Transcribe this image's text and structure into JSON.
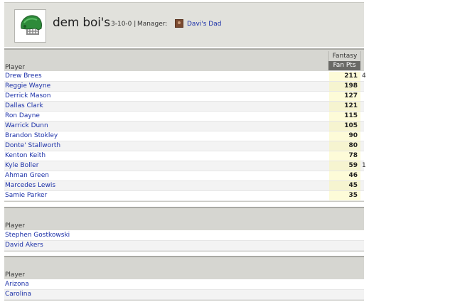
{
  "team": {
    "name": "dem boi's",
    "record": "3-10-0 |",
    "manager_label": "Manager:",
    "manager_name": "Davi's Dad"
  },
  "starters": {
    "player_header": "Player",
    "group_header": "Fantasy",
    "points_header": "Fan Pts",
    "rows": [
      {
        "name": "Drew Brees",
        "pts": "211",
        "cut": "4"
      },
      {
        "name": "Reggie Wayne",
        "pts": "198",
        "cut": ""
      },
      {
        "name": "Derrick Mason",
        "pts": "127",
        "cut": ""
      },
      {
        "name": "Dallas Clark",
        "pts": "121",
        "cut": ""
      },
      {
        "name": "Ron Dayne",
        "pts": "115",
        "cut": ""
      },
      {
        "name": "Warrick Dunn",
        "pts": "105",
        "cut": ""
      },
      {
        "name": "Brandon Stokley",
        "pts": "90",
        "cut": ""
      },
      {
        "name": "Donte' Stallworth",
        "pts": "80",
        "cut": ""
      },
      {
        "name": "Kenton Keith",
        "pts": "78",
        "cut": ""
      },
      {
        "name": "Kyle Boller",
        "pts": "59",
        "cut": "1"
      },
      {
        "name": "Ahman Green",
        "pts": "46",
        "cut": ""
      },
      {
        "name": "Marcedes Lewis",
        "pts": "45",
        "cut": ""
      },
      {
        "name": "Samie Parker",
        "pts": "35",
        "cut": ""
      }
    ]
  },
  "kickers": {
    "player_header": "Player",
    "rows": [
      {
        "name": "Stephen Gostkowski"
      },
      {
        "name": "David Akers"
      }
    ]
  },
  "defenses": {
    "player_header": "Player",
    "rows": [
      {
        "name": "Arizona"
      },
      {
        "name": "Carolina"
      }
    ]
  },
  "colors": {
    "link": "#1a2fa8",
    "header_bg": "#e1e1dc",
    "section_head_bg": "#d6d6d1",
    "points_header_bg": "#6a6a66",
    "points_cell_bg": "#fdfbd8"
  },
  "icons": {
    "team_logo": "football-helmet-icon",
    "manager_avatar": "manager-avatar-icon"
  }
}
